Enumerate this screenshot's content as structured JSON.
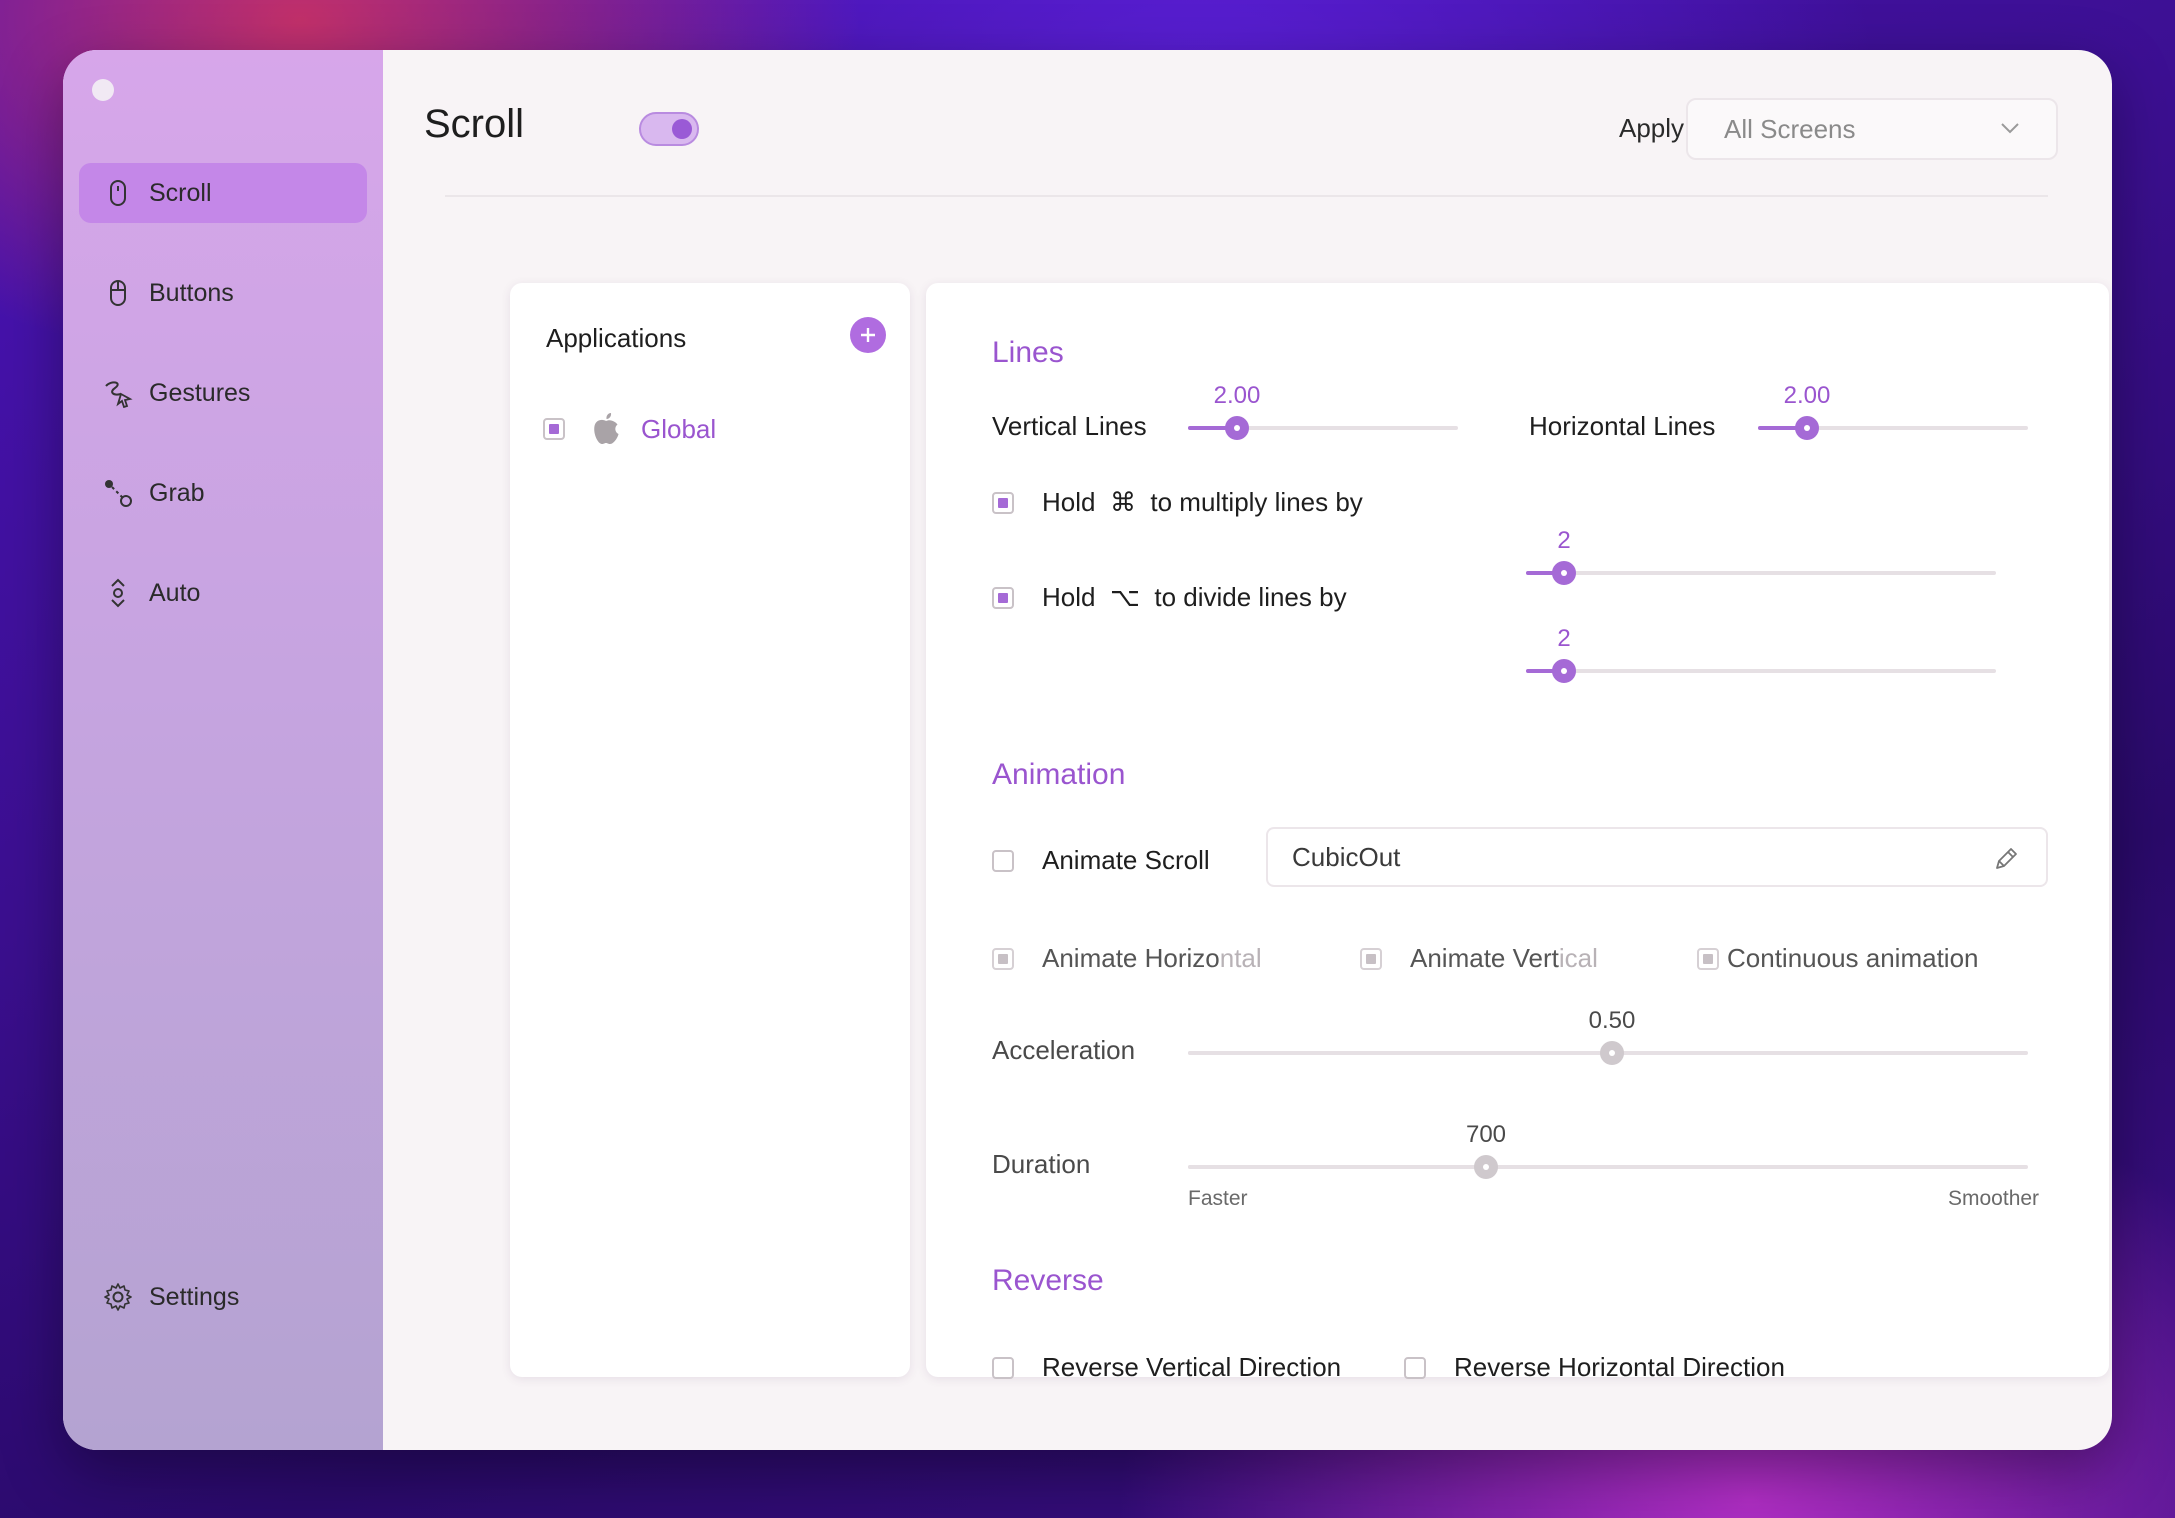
{
  "sidebar": {
    "items": [
      {
        "label": "Scroll",
        "icon": "mouse-icon",
        "active": true
      },
      {
        "label": "Buttons",
        "icon": "mouse-icon"
      },
      {
        "label": "Gestures",
        "icon": "gesture-icon"
      },
      {
        "label": "Grab",
        "icon": "grab-icon"
      },
      {
        "label": "Auto",
        "icon": "auto-icon"
      }
    ],
    "settings_label": "Settings"
  },
  "header": {
    "title": "Scroll",
    "toggle_on": true,
    "apply_label": "Apply to",
    "apply_value": "All Screens"
  },
  "applications": {
    "title": "Applications",
    "items": [
      {
        "label": "Global",
        "checked": true
      }
    ]
  },
  "lines": {
    "title": "Lines",
    "vertical_label": "Vertical Lines",
    "vertical_value": "2.00",
    "vertical_fraction": 0.18,
    "horizontal_label": "Horizontal Lines",
    "horizontal_value": "2.00",
    "horizontal_fraction": 0.18,
    "multiply": {
      "prefix": "Hold",
      "key": "⌘",
      "suffix": "to multiply lines by",
      "value": "2",
      "checked": true,
      "fraction": 0.08
    },
    "divide": {
      "prefix": "Hold",
      "key": "⌥",
      "suffix": "to divide lines by",
      "value": "2",
      "checked": true,
      "fraction": 0.08
    }
  },
  "animation": {
    "title": "Animation",
    "animate_scroll_label": "Animate Scroll",
    "animate_scroll_checked": false,
    "curve_value": "CubicOut",
    "animate_horizontal_a": "Animate Horizo",
    "animate_horizontal_b": "ntal",
    "animate_vertical_a": "Animate Vert",
    "animate_vertical_b": "ical",
    "continuous_label": "Continuous animation",
    "acceleration_label": "Acceleration",
    "acceleration_value": "0.50",
    "acceleration_fraction": 0.505,
    "duration_label": "Duration",
    "duration_value": "700",
    "duration_fraction": 0.355,
    "faster_label": "Faster",
    "smoother_label": "Smoother"
  },
  "reverse": {
    "title": "Reverse",
    "vertical_label": "Reverse Vertical Direction",
    "horizontal_label": "Reverse Horizontal Direction"
  },
  "colors": {
    "accent": "#a56ad6",
    "sidebar_active": "#c487e8"
  }
}
